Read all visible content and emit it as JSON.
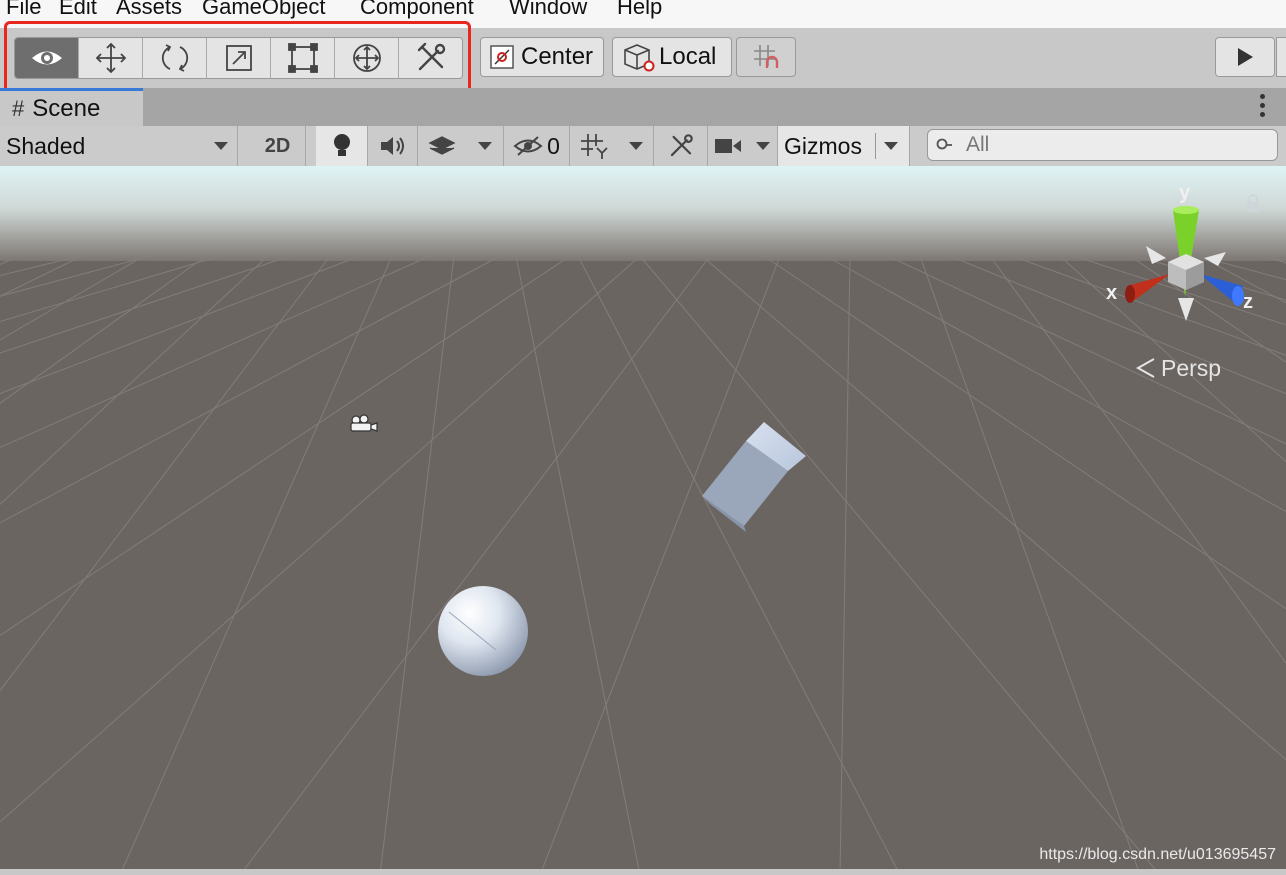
{
  "menu": {
    "items": [
      "File",
      "Edit",
      "Assets",
      "GameObject",
      "Component",
      "Window",
      "Help"
    ]
  },
  "toolbar": {
    "tools": [
      {
        "name": "view-tool",
        "icon": "eye-icon",
        "active": true
      },
      {
        "name": "move-tool",
        "icon": "move-arrows-icon",
        "active": false
      },
      {
        "name": "rotate-tool",
        "icon": "rotate-icon",
        "active": false
      },
      {
        "name": "scale-tool",
        "icon": "scale-icon",
        "active": false
      },
      {
        "name": "rect-tool",
        "icon": "rect-transform-icon",
        "active": false
      },
      {
        "name": "transform-tool",
        "icon": "transform-icon",
        "active": false
      },
      {
        "name": "custom-editor-tool",
        "icon": "wrench-icon",
        "active": false
      }
    ],
    "pivot_center_label": "Center",
    "pivot_local_label": "Local",
    "snap_icon": "grid-snap-icon",
    "play_icon": "play-icon"
  },
  "scene_tab": {
    "label": "Scene",
    "icon": "grid-hash-icon"
  },
  "scene_toolbar": {
    "draw_mode": "Shaded",
    "mode_2d": "2D",
    "hidden_count": "0",
    "gizmos_label": "Gizmos",
    "search_placeholder": "All"
  },
  "scene_view": {
    "gizmo_axes": {
      "x": "x",
      "y": "y",
      "z": "z"
    },
    "projection_label": "Persp",
    "colors": {
      "sky_top": "#dff3f5",
      "ground": "#6e6764",
      "x_axis": "#c0301c",
      "y_axis": "#7ad12a",
      "z_axis": "#2b5fd8"
    }
  },
  "watermark": "https://blog.csdn.net/u013695457"
}
